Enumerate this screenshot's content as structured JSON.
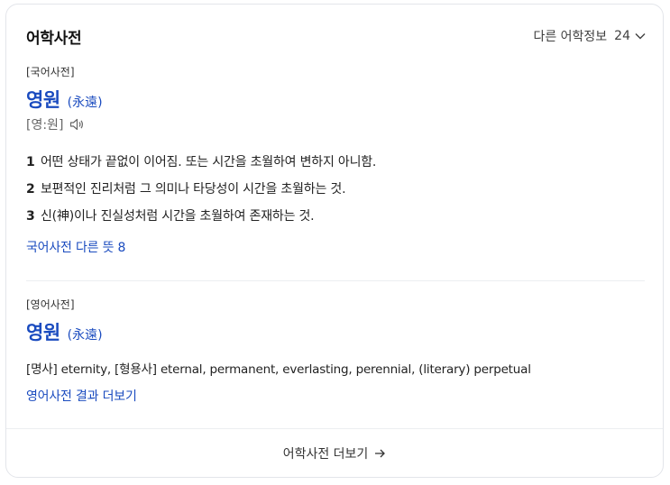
{
  "card": {
    "title": "어학사전",
    "more_info": {
      "label": "다른 어학정보",
      "count": "24"
    }
  },
  "korean_dict": {
    "source": "[국어사전]",
    "headword": "영원",
    "hanja": "(永遠)",
    "pronunciation": "[영:원]",
    "definitions": [
      {
        "num": "1",
        "text": "어떤 상태가 끝없이 이어짐. 또는 시간을 초월하여 변하지 아니함."
      },
      {
        "num": "2",
        "text": "보편적인 진리처럼 그 의미나 타당성이 시간을 초월하는 것."
      },
      {
        "num": "3",
        "text": "신(神)이나 진실성처럼 시간을 초월하여 존재하는 것."
      }
    ],
    "more_link": "국어사전 다른 뜻 8"
  },
  "english_dict": {
    "source": "[영어사전]",
    "headword": "영원",
    "hanja": "(永遠)",
    "translation": "[명사] eternity, [형용사] eternal, permanent, everlasting, perennial, (literary) perpetual",
    "more_link": "영어사전 결과 더보기"
  },
  "footer": {
    "label": "어학사전 더보기"
  },
  "icons": {
    "more_info": "chevron-down-icon",
    "pronunciation": "speaker-icon",
    "footer": "arrow-right-icon"
  },
  "colors": {
    "accent": "#1a4bbf",
    "text": "#222222",
    "muted": "#666666",
    "border": "#e3e5ea"
  }
}
